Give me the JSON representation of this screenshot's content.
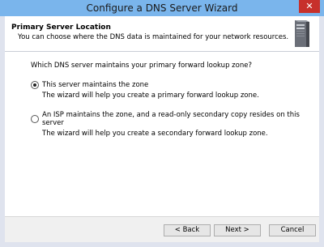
{
  "window": {
    "title": "Configure a DNS Server Wizard",
    "close_glyph": "✕"
  },
  "header": {
    "title": "Primary Server Location",
    "subtitle": "You can choose where the DNS data is maintained for your network resources.",
    "icon": "server-icon"
  },
  "question": "Which DNS server maintains your primary forward lookup zone?",
  "options": [
    {
      "label": "This server maintains the zone",
      "description": "The wizard will help you create a primary forward lookup zone.",
      "selected": true
    },
    {
      "label": "An ISP maintains the zone, and a read-only secondary copy resides on this server",
      "description": "The wizard will help you create a secondary forward lookup zone.",
      "selected": false
    }
  ],
  "buttons": {
    "back": "< Back",
    "next": "Next >",
    "cancel": "Cancel"
  }
}
